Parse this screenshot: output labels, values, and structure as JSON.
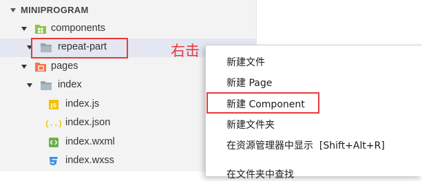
{
  "explorer": {
    "section_title": "MINIPROGRAM",
    "tree": [
      {
        "label": "components",
        "icon": "components-folder-icon",
        "expanded": true
      },
      {
        "label": "repeat-part",
        "icon": "folder-icon",
        "expanded": true,
        "selected": true
      },
      {
        "label": "pages",
        "icon": "pages-folder-icon",
        "expanded": true
      },
      {
        "label": "index",
        "icon": "folder-icon",
        "expanded": true
      },
      {
        "label": "index.js",
        "icon": "js-file-icon"
      },
      {
        "label": "index.json",
        "icon": "json-file-icon"
      },
      {
        "label": "index.wxml",
        "icon": "wxml-file-icon"
      },
      {
        "label": "index.wxss",
        "icon": "wxss-file-icon"
      }
    ]
  },
  "annotation": {
    "right_click_text": "右击",
    "color": "#e33a3a"
  },
  "context_menu": {
    "items": [
      {
        "label": "新建文件"
      },
      {
        "label": "新建 Page"
      },
      {
        "label": "新建 Component",
        "highlighted": true
      },
      {
        "label": "新建文件夹"
      },
      {
        "label": "在资源管理器中显示  [Shift+Alt+R]"
      }
    ],
    "partial_item": "在文件夹中查找"
  },
  "colors": {
    "sidebar_bg": "#f3f3f3",
    "selected_row": "#e4e6f1",
    "components_folder": "#8bc34a",
    "pages_folder": "#f4764a",
    "plain_folder": "#90a4ae",
    "js_icon": "#f2c200",
    "json_icon": "#f2c200",
    "wxml_icon": "#6ab04c",
    "wxss_icon": "#3a8ee6"
  }
}
